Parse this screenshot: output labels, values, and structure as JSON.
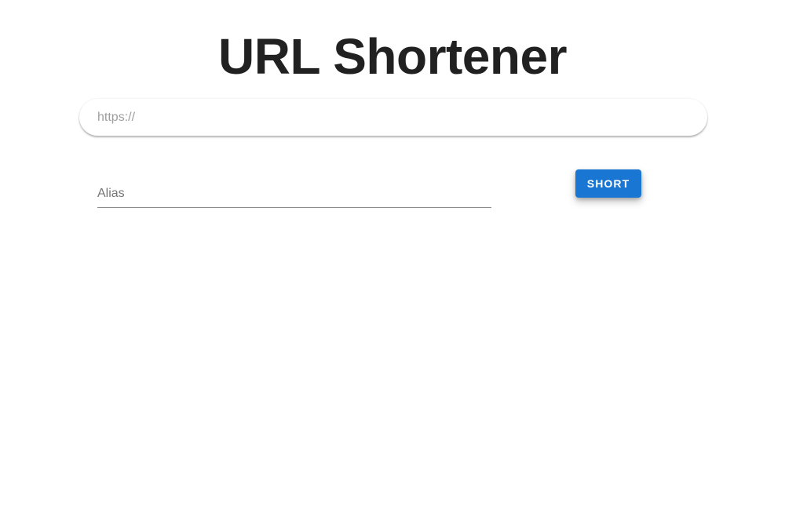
{
  "header": {
    "title": "URL Shortener"
  },
  "form": {
    "url_placeholder": "https://",
    "url_value": "",
    "alias_label": "Alias",
    "alias_value": "",
    "submit_label": "SHORT"
  },
  "colors": {
    "primary": "#1976d2",
    "title_text": "#212121"
  }
}
